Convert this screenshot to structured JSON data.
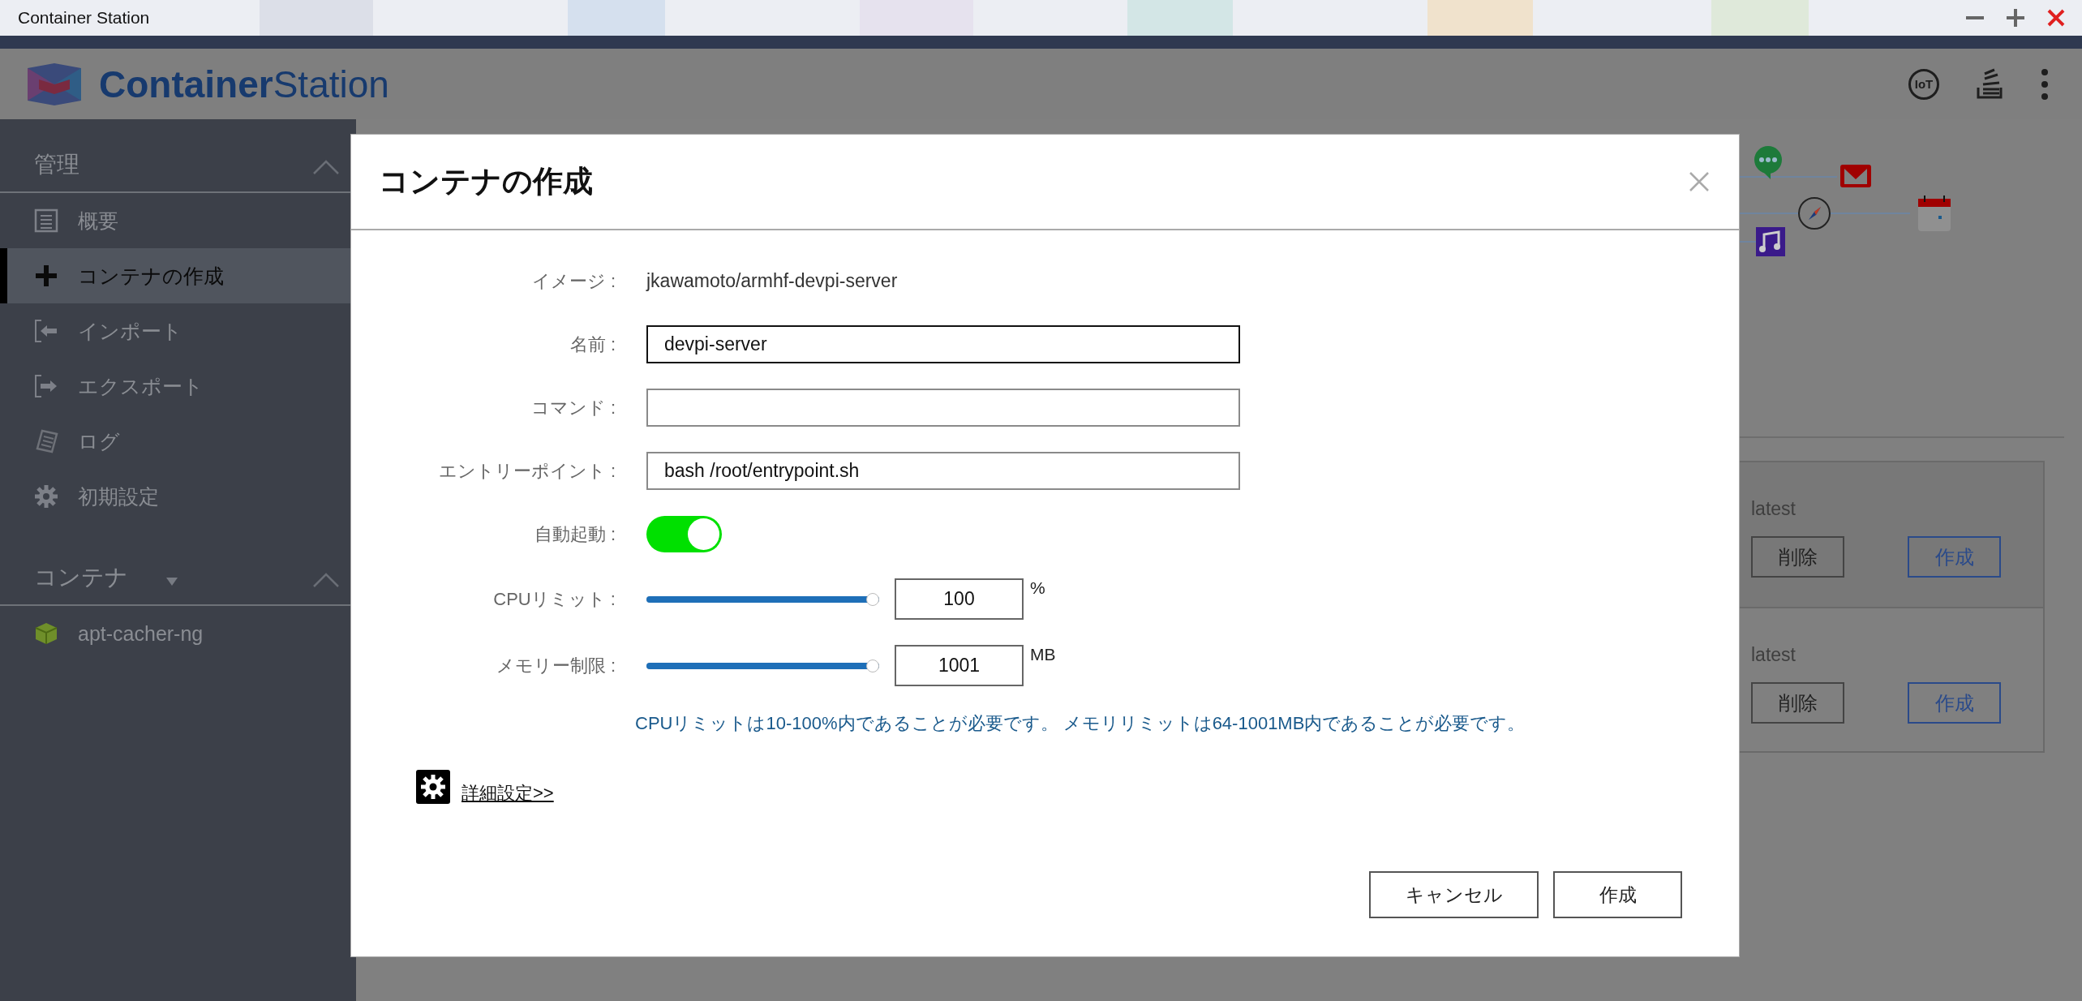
{
  "window": {
    "title": "Container Station"
  },
  "app": {
    "logo_bold": "Container",
    "logo_light": "Station"
  },
  "header_icons": [
    {
      "kind": "iot",
      "label": "IoT"
    },
    {
      "kind": "stack"
    },
    {
      "kind": "more"
    }
  ],
  "sidebar": {
    "sections": [
      {
        "title": "管理",
        "expanded": true,
        "dropdown": false,
        "items": [
          {
            "label": "概要",
            "kind": "overview",
            "selected": false
          },
          {
            "label": "コンテナの作成",
            "kind": "plus",
            "selected": true
          },
          {
            "label": "インポート",
            "kind": "import",
            "selected": false
          },
          {
            "label": "エクスポート",
            "kind": "export",
            "selected": false
          },
          {
            "label": "ログ",
            "kind": "log",
            "selected": false
          },
          {
            "label": "初期設定",
            "kind": "gear",
            "selected": false
          }
        ]
      },
      {
        "title": "コンテナ",
        "expanded": true,
        "dropdown": true,
        "items": [
          {
            "label": "apt-cacher-ng",
            "kind": "container",
            "selected": false
          }
        ]
      }
    ]
  },
  "background": {
    "cards": [
      {
        "tag": "latest",
        "buttons": [
          {
            "label": "削除",
            "kind": "plain"
          },
          {
            "label": "作成",
            "kind": "primary"
          }
        ]
      },
      {
        "tag": "latest",
        "buttons": [
          {
            "label": "削除",
            "kind": "plain"
          },
          {
            "label": "作成",
            "kind": "primary"
          }
        ]
      }
    ]
  },
  "dialog": {
    "title": "コンテナの作成",
    "fields": [
      {
        "kind": "text",
        "label": "イメージ :",
        "value": "jkawamoto/armhf-devpi-server"
      },
      {
        "kind": "input",
        "label": "名前 :",
        "value": "devpi-server",
        "focused": true
      },
      {
        "kind": "input",
        "label": "コマンド :",
        "focused": false
      },
      {
        "kind": "input",
        "label": "エントリーポイント :",
        "value": "bash /root/entrypoint.sh",
        "focused": false
      },
      {
        "kind": "toggle",
        "label": "自動起動 :",
        "on": true
      },
      {
        "kind": "slider",
        "label": "CPUリミット :",
        "level": 1,
        "value": "100",
        "unit": "%"
      },
      {
        "kind": "slider",
        "label": "メモリー制限 :",
        "level": 1,
        "value": "1001",
        "unit": "MB"
      }
    ],
    "hint": "CPUリミットは10-100%内であることが必要です。 メモリリミットは64-1001MB内であることが必要です。",
    "advanced_link": "詳細設定>>",
    "buttons": [
      {
        "label": "キャンセル",
        "kind": "secondary"
      },
      {
        "label": "作成",
        "kind": "primary"
      }
    ]
  }
}
